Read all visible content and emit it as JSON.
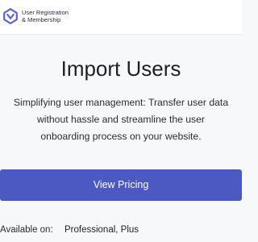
{
  "header": {
    "logo_icon": "user-registration-logo-icon",
    "brand_line1": "User Registration",
    "brand_line2": "& Membership",
    "brand_color": "#5a63d3"
  },
  "main": {
    "title": "Import Users",
    "description": "Simplifying user management: Transfer user data without hassle and streamline the user onboarding process on your website.",
    "cta_label": "View Pricing",
    "cta_color": "#4d59c2",
    "available_label": "Available on:",
    "available_value": "Professional, Plus"
  }
}
